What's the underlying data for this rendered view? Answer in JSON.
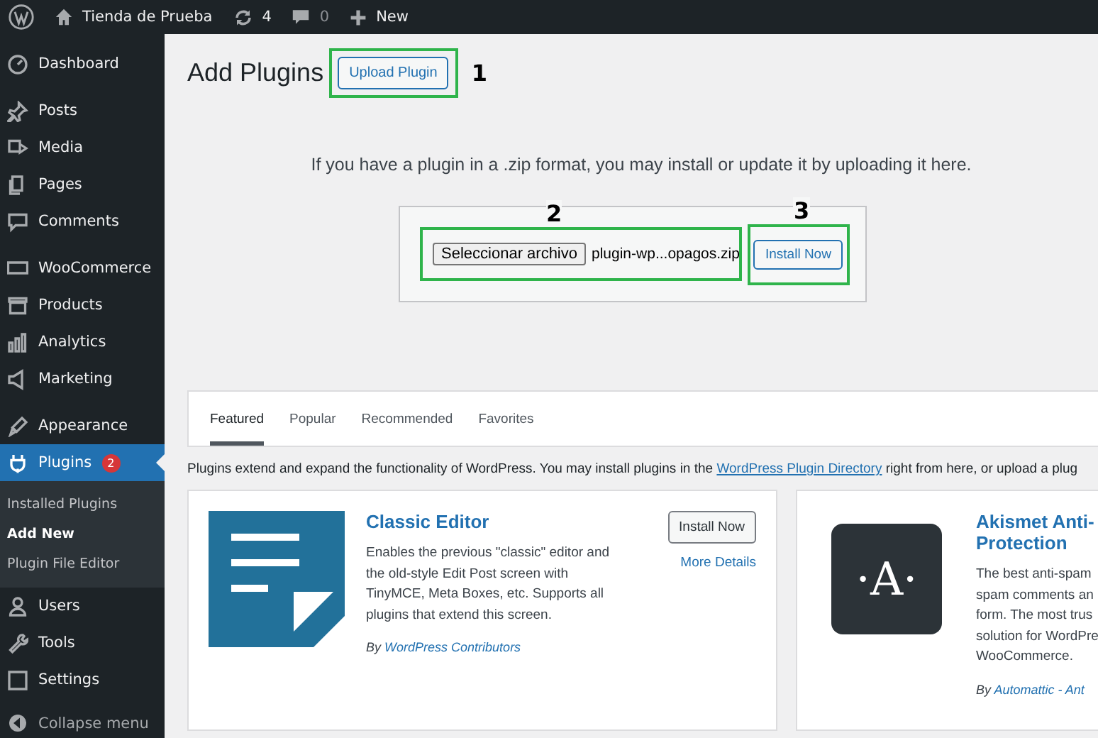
{
  "admin_bar": {
    "site_name": "Tienda de Prueba",
    "updates": "4",
    "comments": "0",
    "new_label": "New"
  },
  "sidebar": {
    "groups": [
      [
        {
          "label": "Dashboard",
          "selected": false
        }
      ],
      [
        {
          "label": "Posts",
          "selected": false
        },
        {
          "label": "Media",
          "selected": false
        },
        {
          "label": "Pages",
          "selected": false
        },
        {
          "label": "Comments",
          "selected": false
        }
      ],
      [
        {
          "label": "WooCommerce",
          "selected": false
        },
        {
          "label": "Products",
          "selected": false
        },
        {
          "label": "Analytics",
          "selected": false
        },
        {
          "label": "Marketing",
          "selected": false
        }
      ],
      [
        {
          "label": "Appearance",
          "selected": false
        },
        {
          "label": "Plugins",
          "selected": true,
          "badge": "2",
          "children": [
            {
              "label": "Installed Plugins",
              "selected": false
            },
            {
              "label": "Add New",
              "selected": true
            },
            {
              "label": "Plugin File Editor",
              "selected": false
            }
          ]
        },
        {
          "label": "Users",
          "selected": false
        },
        {
          "label": "Tools",
          "selected": false
        },
        {
          "label": "Settings",
          "selected": false
        }
      ]
    ],
    "collapse": "Collapse menu"
  },
  "page_title": "Add Plugins",
  "upload_button": "Upload Plugin",
  "upload": {
    "help": "If you have a plugin in a .zip format, you may install or update it by uploading it here.",
    "choose_button": "Seleccionar archivo",
    "file_name": "plugin-wp...opagos.zip",
    "install_button": "Install Now"
  },
  "annotations": [
    {
      "label": "1"
    },
    {
      "label": "2"
    },
    {
      "label": "3"
    }
  ],
  "tabs": [
    {
      "label": "Featured",
      "selected": true
    },
    {
      "label": "Popular",
      "selected": false
    },
    {
      "label": "Recommended",
      "selected": false
    },
    {
      "label": "Favorites",
      "selected": false
    }
  ],
  "intro": {
    "before": "Plugins extend and expand the functionality of WordPress. You may install plugins in the ",
    "link": "WordPress Plugin Directory",
    "after": " right from here, or upload a plug"
  },
  "cards": [
    {
      "kind": "classic",
      "title": [
        "Classic Editor"
      ],
      "description": [
        "Enables the previous \"classic\" editor and the old-style Edit Post screen with TinyMCE, Meta Boxes, etc. Supports all plugins that extend this screen."
      ],
      "install": "Install Now",
      "details": "More Details",
      "by": "By",
      "author": "WordPress Contributors"
    },
    {
      "kind": "akismet",
      "logo_text": "·A·",
      "title": [
        "Akismet Anti-",
        "Protection"
      ],
      "description": [
        "The best anti-spam",
        "spam comments an",
        "form. The most trus",
        "solution for WordPre",
        "WooCommerce."
      ],
      "by": "By",
      "author": "Automattic - Ant"
    }
  ]
}
